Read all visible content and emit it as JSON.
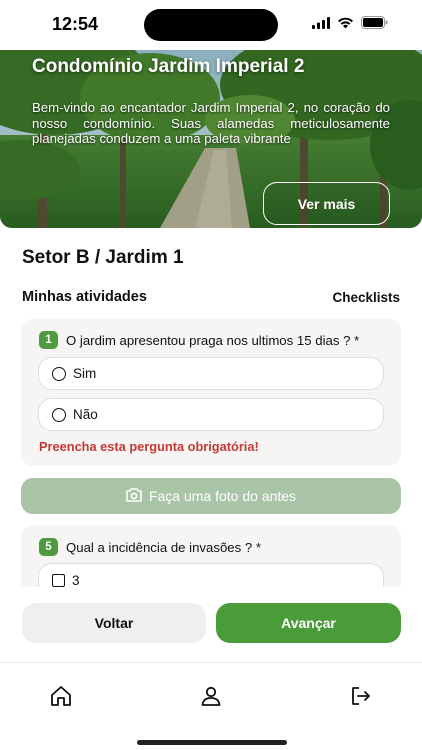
{
  "status": {
    "time": "12:54",
    "icons": [
      "signal-icon",
      "wifi-icon",
      "battery-icon"
    ]
  },
  "hero": {
    "title": "Condomínio Jardim Imperial 2",
    "description": "Bem-vindo ao encantador Jardim Imperial 2, no coração do nosso condomínio. Suas alamedas meticulosamente planejadas conduzem a uma paleta vibrante",
    "button_label": "Ver mais"
  },
  "sector_title": "Setor B / Jardim 1",
  "section": {
    "left": "Minhas atividades",
    "right": "Checklists"
  },
  "question1": {
    "number": "1",
    "text": "O jardim apresentou praga nos ultimos 15 dias ? *",
    "options": [
      "Sim",
      "Não"
    ],
    "error": "Preencha esta pergunta obrigatória!"
  },
  "photo_button": {
    "label": "Faça uma foto do antes",
    "icon": "camera-icon"
  },
  "question2": {
    "number": "5",
    "text": "Qual a incidência de invasões ? *",
    "options": [
      "3"
    ]
  },
  "actions": {
    "back_label": "Voltar",
    "next_label": "Avançar"
  },
  "tabbar": {
    "icons": [
      "home-icon",
      "user-icon",
      "logout-icon"
    ]
  },
  "colors": {
    "accent": "#4a9b39",
    "badge": "#4e9a3e",
    "error": "#c43a35",
    "disabled_button": "#a9c4a7"
  }
}
